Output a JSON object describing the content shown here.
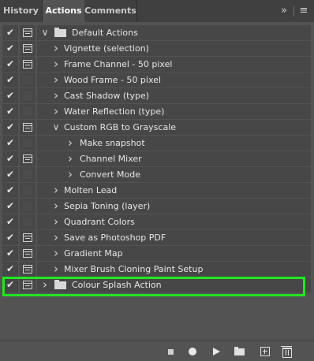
{
  "tabs": [
    {
      "label": "History",
      "active": false
    },
    {
      "label": "Actions",
      "active": true
    },
    {
      "label": "Comments",
      "active": false
    }
  ],
  "header": {
    "expand_glyph": "»",
    "menu_glyph": "≡"
  },
  "rows": [
    {
      "label": "Default Actions",
      "level": 0,
      "checked": true,
      "dialog": true,
      "expander": "open",
      "folder": true
    },
    {
      "label": "Vignette (selection)",
      "level": 1,
      "checked": true,
      "dialog": true,
      "expander": "closed",
      "folder": false
    },
    {
      "label": "Frame Channel - 50 pixel",
      "level": 1,
      "checked": true,
      "dialog": true,
      "expander": "closed",
      "folder": false
    },
    {
      "label": "Wood Frame - 50 pixel",
      "level": 1,
      "checked": true,
      "dialog": false,
      "expander": "closed",
      "folder": false
    },
    {
      "label": "Cast Shadow (type)",
      "level": 1,
      "checked": true,
      "dialog": false,
      "expander": "closed",
      "folder": false
    },
    {
      "label": "Water Reflection (type)",
      "level": 1,
      "checked": true,
      "dialog": false,
      "expander": "closed",
      "folder": false
    },
    {
      "label": "Custom RGB to Grayscale",
      "level": 1,
      "checked": true,
      "dialog": true,
      "expander": "open",
      "folder": false
    },
    {
      "label": "Make snapshot",
      "level": 2,
      "checked": true,
      "dialog": false,
      "expander": "closed",
      "folder": false
    },
    {
      "label": "Channel Mixer",
      "level": 2,
      "checked": true,
      "dialog": true,
      "expander": "closed",
      "folder": false
    },
    {
      "label": "Convert Mode",
      "level": 2,
      "checked": true,
      "dialog": false,
      "expander": "closed",
      "folder": false
    },
    {
      "label": "Molten Lead",
      "level": 1,
      "checked": true,
      "dialog": false,
      "expander": "closed",
      "folder": false
    },
    {
      "label": "Sepia Toning (layer)",
      "level": 1,
      "checked": true,
      "dialog": false,
      "expander": "closed",
      "folder": false
    },
    {
      "label": "Quadrant Colors",
      "level": 1,
      "checked": true,
      "dialog": false,
      "expander": "closed",
      "folder": false
    },
    {
      "label": "Save as Photoshop PDF",
      "level": 1,
      "checked": true,
      "dialog": true,
      "expander": "closed",
      "folder": false
    },
    {
      "label": "Gradient Map",
      "level": 1,
      "checked": true,
      "dialog": true,
      "expander": "closed",
      "folder": false
    },
    {
      "label": "Mixer Brush Cloning Paint Setup",
      "level": 1,
      "checked": true,
      "dialog": true,
      "expander": "closed",
      "folder": false
    },
    {
      "label": "Colour Splash Action",
      "level": 0,
      "checked": true,
      "dialog": true,
      "expander": "closed",
      "folder": true
    }
  ],
  "highlight_color": "#22e622",
  "footer": {
    "buttons": [
      "stop-icon",
      "record-icon",
      "play-icon",
      "new-set-icon",
      "new-action-icon",
      "trash-icon"
    ]
  }
}
